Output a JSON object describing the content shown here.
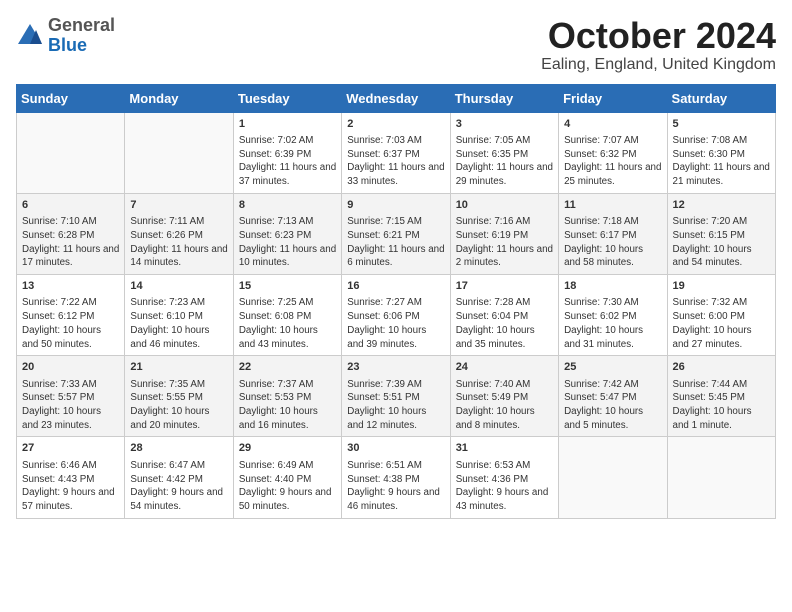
{
  "header": {
    "logo": {
      "general": "General",
      "blue": "Blue"
    },
    "title": "October 2024",
    "location": "Ealing, England, United Kingdom"
  },
  "weekdays": [
    "Sunday",
    "Monday",
    "Tuesday",
    "Wednesday",
    "Thursday",
    "Friday",
    "Saturday"
  ],
  "weeks": [
    [
      {
        "day": "",
        "detail": ""
      },
      {
        "day": "",
        "detail": ""
      },
      {
        "day": "1",
        "detail": "Sunrise: 7:02 AM\nSunset: 6:39 PM\nDaylight: 11 hours and 37 minutes."
      },
      {
        "day": "2",
        "detail": "Sunrise: 7:03 AM\nSunset: 6:37 PM\nDaylight: 11 hours and 33 minutes."
      },
      {
        "day": "3",
        "detail": "Sunrise: 7:05 AM\nSunset: 6:35 PM\nDaylight: 11 hours and 29 minutes."
      },
      {
        "day": "4",
        "detail": "Sunrise: 7:07 AM\nSunset: 6:32 PM\nDaylight: 11 hours and 25 minutes."
      },
      {
        "day": "5",
        "detail": "Sunrise: 7:08 AM\nSunset: 6:30 PM\nDaylight: 11 hours and 21 minutes."
      }
    ],
    [
      {
        "day": "6",
        "detail": "Sunrise: 7:10 AM\nSunset: 6:28 PM\nDaylight: 11 hours and 17 minutes."
      },
      {
        "day": "7",
        "detail": "Sunrise: 7:11 AM\nSunset: 6:26 PM\nDaylight: 11 hours and 14 minutes."
      },
      {
        "day": "8",
        "detail": "Sunrise: 7:13 AM\nSunset: 6:23 PM\nDaylight: 11 hours and 10 minutes."
      },
      {
        "day": "9",
        "detail": "Sunrise: 7:15 AM\nSunset: 6:21 PM\nDaylight: 11 hours and 6 minutes."
      },
      {
        "day": "10",
        "detail": "Sunrise: 7:16 AM\nSunset: 6:19 PM\nDaylight: 11 hours and 2 minutes."
      },
      {
        "day": "11",
        "detail": "Sunrise: 7:18 AM\nSunset: 6:17 PM\nDaylight: 10 hours and 58 minutes."
      },
      {
        "day": "12",
        "detail": "Sunrise: 7:20 AM\nSunset: 6:15 PM\nDaylight: 10 hours and 54 minutes."
      }
    ],
    [
      {
        "day": "13",
        "detail": "Sunrise: 7:22 AM\nSunset: 6:12 PM\nDaylight: 10 hours and 50 minutes."
      },
      {
        "day": "14",
        "detail": "Sunrise: 7:23 AM\nSunset: 6:10 PM\nDaylight: 10 hours and 46 minutes."
      },
      {
        "day": "15",
        "detail": "Sunrise: 7:25 AM\nSunset: 6:08 PM\nDaylight: 10 hours and 43 minutes."
      },
      {
        "day": "16",
        "detail": "Sunrise: 7:27 AM\nSunset: 6:06 PM\nDaylight: 10 hours and 39 minutes."
      },
      {
        "day": "17",
        "detail": "Sunrise: 7:28 AM\nSunset: 6:04 PM\nDaylight: 10 hours and 35 minutes."
      },
      {
        "day": "18",
        "detail": "Sunrise: 7:30 AM\nSunset: 6:02 PM\nDaylight: 10 hours and 31 minutes."
      },
      {
        "day": "19",
        "detail": "Sunrise: 7:32 AM\nSunset: 6:00 PM\nDaylight: 10 hours and 27 minutes."
      }
    ],
    [
      {
        "day": "20",
        "detail": "Sunrise: 7:33 AM\nSunset: 5:57 PM\nDaylight: 10 hours and 23 minutes."
      },
      {
        "day": "21",
        "detail": "Sunrise: 7:35 AM\nSunset: 5:55 PM\nDaylight: 10 hours and 20 minutes."
      },
      {
        "day": "22",
        "detail": "Sunrise: 7:37 AM\nSunset: 5:53 PM\nDaylight: 10 hours and 16 minutes."
      },
      {
        "day": "23",
        "detail": "Sunrise: 7:39 AM\nSunset: 5:51 PM\nDaylight: 10 hours and 12 minutes."
      },
      {
        "day": "24",
        "detail": "Sunrise: 7:40 AM\nSunset: 5:49 PM\nDaylight: 10 hours and 8 minutes."
      },
      {
        "day": "25",
        "detail": "Sunrise: 7:42 AM\nSunset: 5:47 PM\nDaylight: 10 hours and 5 minutes."
      },
      {
        "day": "26",
        "detail": "Sunrise: 7:44 AM\nSunset: 5:45 PM\nDaylight: 10 hours and 1 minute."
      }
    ],
    [
      {
        "day": "27",
        "detail": "Sunrise: 6:46 AM\nSunset: 4:43 PM\nDaylight: 9 hours and 57 minutes."
      },
      {
        "day": "28",
        "detail": "Sunrise: 6:47 AM\nSunset: 4:42 PM\nDaylight: 9 hours and 54 minutes."
      },
      {
        "day": "29",
        "detail": "Sunrise: 6:49 AM\nSunset: 4:40 PM\nDaylight: 9 hours and 50 minutes."
      },
      {
        "day": "30",
        "detail": "Sunrise: 6:51 AM\nSunset: 4:38 PM\nDaylight: 9 hours and 46 minutes."
      },
      {
        "day": "31",
        "detail": "Sunrise: 6:53 AM\nSunset: 4:36 PM\nDaylight: 9 hours and 43 minutes."
      },
      {
        "day": "",
        "detail": ""
      },
      {
        "day": "",
        "detail": ""
      }
    ]
  ]
}
